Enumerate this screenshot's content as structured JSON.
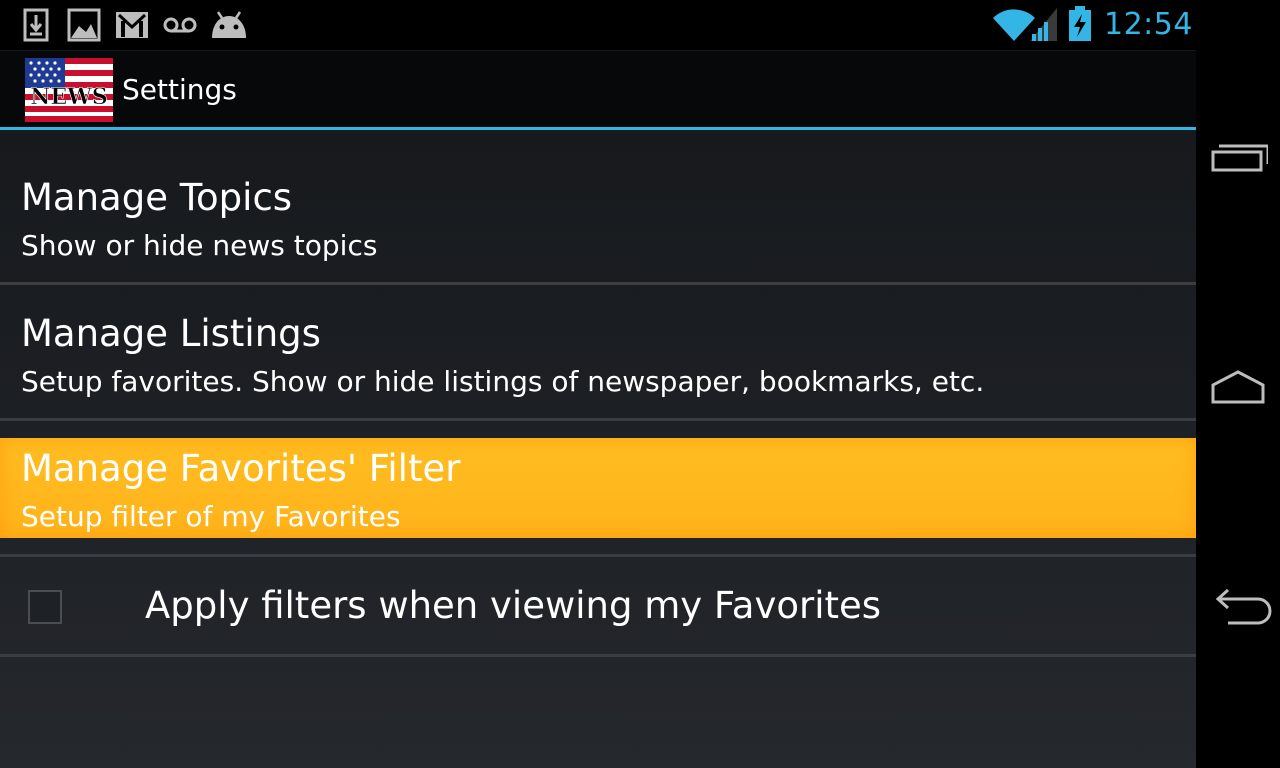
{
  "status_bar": {
    "time": "12:54",
    "notification_icons": [
      "download-icon",
      "gallery-icon",
      "gmail-icon",
      "voicemail-icon",
      "android-icon"
    ],
    "system_icons": [
      "wifi-icon",
      "signal-icon",
      "battery-charging-icon"
    ],
    "accent_color": "#33b5e5"
  },
  "action_bar": {
    "title": "Settings",
    "app_icon": "news-flag-app-icon",
    "app_icon_text": "NEWS"
  },
  "preferences": [
    {
      "title": "Manage Topics",
      "summary": "Show or hide news topics"
    },
    {
      "title": "Manage Listings",
      "summary": "Setup favorites. Show or hide listings of newspaper, bookmarks, etc."
    },
    {
      "title": "Manage Favorites' Filter",
      "summary": "Setup filter of my Favorites",
      "highlight_color": "#ffb81f"
    }
  ],
  "checkbox_pref": {
    "label": "Apply filters when viewing my Favorites",
    "checked": false
  },
  "nav_bar": {
    "buttons": [
      "recent-apps-icon",
      "home-icon",
      "back-icon"
    ]
  }
}
